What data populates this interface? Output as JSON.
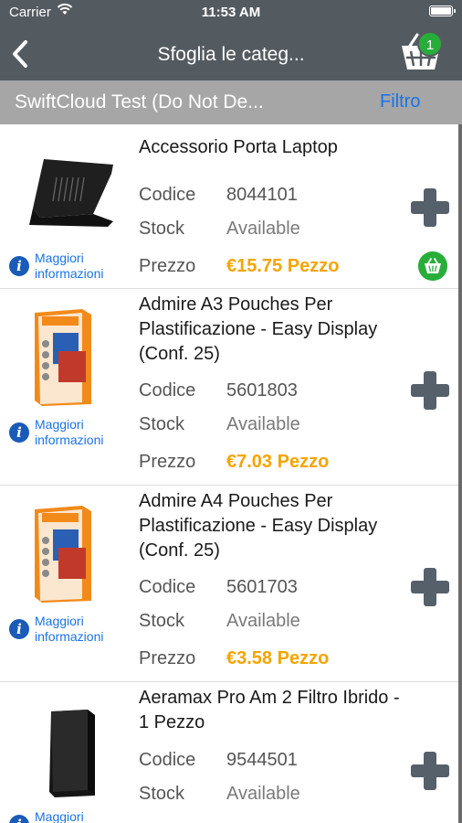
{
  "status_bar": {
    "carrier": "Carrier",
    "time": "11:53 AM"
  },
  "nav": {
    "title": "Sfoglia le categ...",
    "cart_count": "1"
  },
  "subheader": {
    "store": "SwiftCloud Test (Do Not De...",
    "filter_label": "Filtro"
  },
  "labels": {
    "more_info": "Maggiori informazioni",
    "code": "Codice",
    "stock": "Stock",
    "price": "Prezzo"
  },
  "products": [
    {
      "name": "Accessorio Porta Laptop",
      "code": "8044101",
      "stock": "Available",
      "price": "€15.75 Pezzo",
      "in_cart": true
    },
    {
      "name": "Admire A3 Pouches Per Plastificazione - Easy Display (Conf. 25)",
      "code": "5601803",
      "stock": "Available",
      "price": "€7.03 Pezzo",
      "in_cart": false
    },
    {
      "name": "Admire A4 Pouches Per Plastificazione - Easy Display (Conf. 25)",
      "code": "5601703",
      "stock": "Available",
      "price": "€3.58 Pezzo",
      "in_cart": false
    },
    {
      "name": "Aeramax Pro Am 2 Filtro Ibrido - 1 Pezzo",
      "code": "9544501",
      "stock": "Available",
      "price": "",
      "in_cart": false
    }
  ],
  "colors": {
    "header": "#545b60",
    "subheader": "#a6a6a6",
    "link": "#1a73e8",
    "price": "#f5a400",
    "cart_green": "#27ae3a",
    "add_icon": "#55606a"
  }
}
